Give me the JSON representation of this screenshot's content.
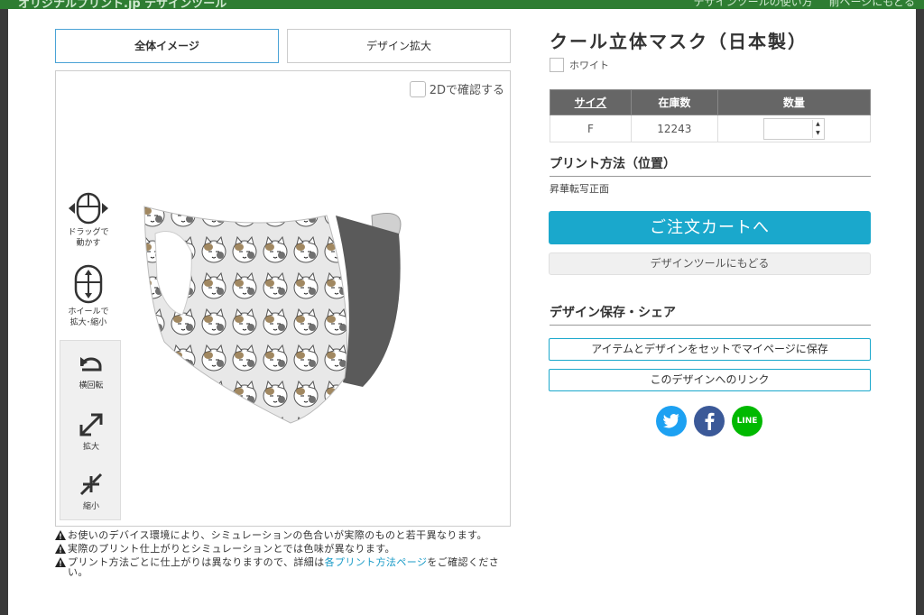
{
  "background": {
    "site_title": "オリジナルプリント.jp デザインツール",
    "links": [
      "デザインツールの使い方",
      "前ページにもどる"
    ]
  },
  "tabs": [
    {
      "label": "全体イメージ",
      "active": true
    },
    {
      "label": "デザイン拡大",
      "active": false
    }
  ],
  "viewer": {
    "toggle_2d_label": "2Dで確認する",
    "hints": {
      "drag": "ドラッグで\n動かす",
      "wheel": "ホイールで\n拡大･縮小"
    },
    "controls": {
      "rotate": "横回転",
      "zoom_in": "拡大",
      "zoom_out": "縮小"
    }
  },
  "notes": [
    "お使いのデバイス環境により、シミュレーションの色合いが実際のものと若干異なります。",
    "実際のプリント仕上がりとシミュレーションとでは色味が異なります。"
  ],
  "note3": {
    "before": "プリント方法ごとに仕上がりは異なりますので、詳細は",
    "link": "各プリント方法ページ",
    "after": "をご確認ください。"
  },
  "product": {
    "title": "クール立体マスク（日本製）",
    "color": "ホワイト"
  },
  "stock_table": {
    "headers": [
      "サイズ",
      "在庫数",
      "数量"
    ],
    "rows": [
      {
        "size": "F",
        "stock": "12243",
        "qty": ""
      }
    ]
  },
  "print": {
    "heading": "プリント方法（位置）",
    "method": "昇華転写正面"
  },
  "buttons": {
    "cart": "ご注文カートへ",
    "back": "デザインツールにもどる",
    "save": "アイテムとデザインをセットでマイページに保存",
    "link": "このデザインへのリンク"
  },
  "share": {
    "heading": "デザイン保存・シェア",
    "line": "LINE"
  },
  "colors": {
    "accent": "#1aa8cc",
    "header_green": "#2e7d32",
    "table_header": "#666666",
    "twitter": "#1da1f2",
    "facebook": "#3b5998",
    "line": "#00b900"
  }
}
